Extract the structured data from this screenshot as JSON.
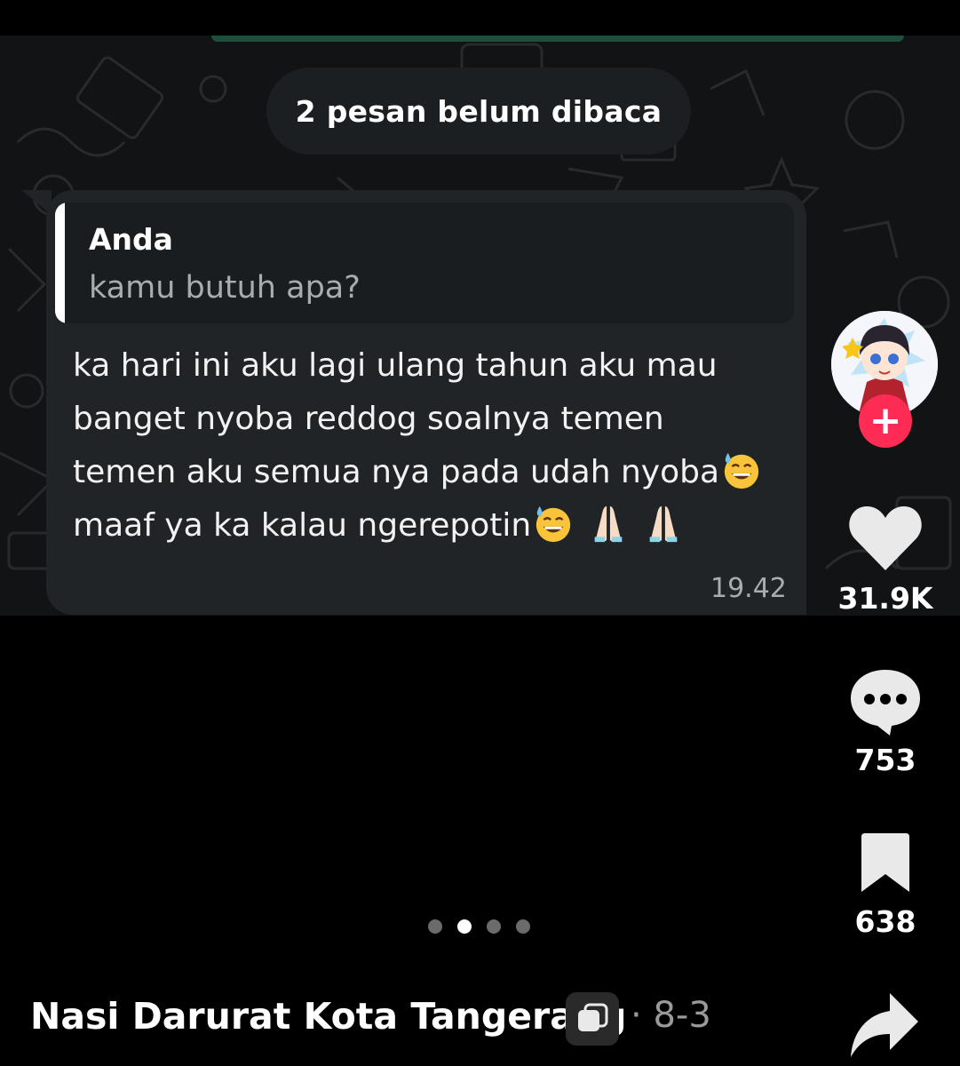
{
  "chat": {
    "unread_banner": "2 pesan belum dibaca",
    "quoted": {
      "author": "Anda",
      "text": "kamu butuh apa?"
    },
    "message": {
      "lines": [
        "ka hari ini aku lagi ulang tahun aku mau",
        "banget nyoba reddog soalnya temen",
        "temen aku semua nya pada udah nyoba",
        "maaf ya ka kalau ngerepotin"
      ],
      "emoji": [
        "grinning-sweat-emoji",
        "grinning-sweat-emoji",
        "folded-hands-emoji",
        "folded-hands-emoji"
      ]
    },
    "time": "19.42"
  },
  "actions": {
    "likes": "31.9K",
    "comments": "753",
    "bookmarks": "638"
  },
  "carousel": {
    "total": 4,
    "active_index": 1
  },
  "footer": {
    "title": "Nasi Darurat Kota Tangerang",
    "separator": "·",
    "date": "8-3"
  },
  "colors": {
    "follow": "#fe2c55",
    "bubble": "#202426",
    "chat_bg": "#111315"
  }
}
